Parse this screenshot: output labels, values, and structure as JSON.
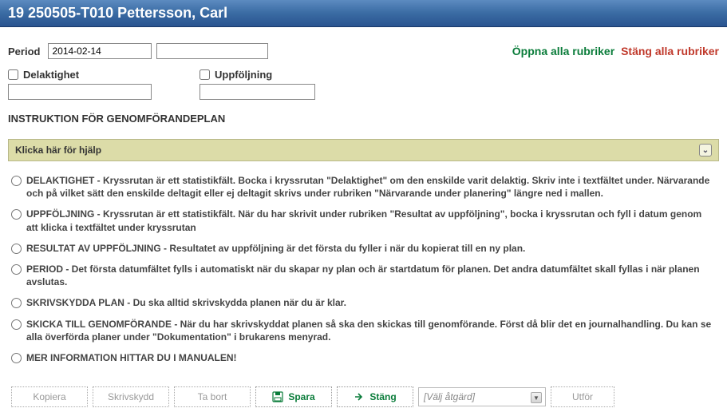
{
  "header": {
    "title": "19 250505-T010 Pettersson, Carl"
  },
  "period": {
    "label": "Period",
    "date": "2014-02-14",
    "extra": ""
  },
  "links": {
    "open_all": "Öppna alla rubriker",
    "close_all": "Stäng alla rubriker"
  },
  "checks": {
    "delaktighet": {
      "label": "Delaktighet",
      "value": ""
    },
    "uppfoljning": {
      "label": "Uppföljning",
      "value": ""
    }
  },
  "instruction_heading": "INSTRUKTION FÖR GENOMFÖRANDEPLAN",
  "help_bar": "Klicka här för hjälp",
  "radios": [
    "DELAKTIGHET - Kryssrutan är ett statistikfält. Bocka i kryssrutan \"Delaktighet\" om den enskilde varit delaktig. Skriv inte i textfältet under. Närvarande och på vilket sätt den enskilde deltagit eller ej deltagit skrivs under rubriken \"Närvarande under planering\" längre ned i mallen.",
    "UPPFÖLJNING - Kryssrutan är ett statistikfält. När du har skrivit under rubriken \"Resultat av uppföljning\", bocka i kryssrutan och fyll i datum genom att klicka i textfältet under kryssrutan",
    "RESULTAT AV UPPFÖLJNING - Resultatet av uppföljning är det första du fyller i när du kopierat till en ny plan.",
    "PERIOD - Det första datumfältet fylls i automatiskt när du skapar ny plan och är startdatum för planen. Det andra datumfältet skall fyllas i när planen avslutas.",
    "SKRIVSKYDDA PLAN - Du ska alltid skrivskydda planen när du är klar.",
    "SKICKA TILL GENOMFÖRANDE - När du har skrivskyddat planen så ska den skickas till genomförande. Först då blir det en journalhandling. Du kan se alla överförda planer under \"Dokumentation\" i brukarens menyrad.",
    "MER INFORMATION HITTAR DU I MANUALEN!"
  ],
  "actions": {
    "kopiera": "Kopiera",
    "skrivskydd": "Skrivskydd",
    "tabort": "Ta bort",
    "spara": "Spara",
    "stang": "Stäng",
    "select": "[Välj åtgärd]",
    "utfor": "Utför"
  }
}
